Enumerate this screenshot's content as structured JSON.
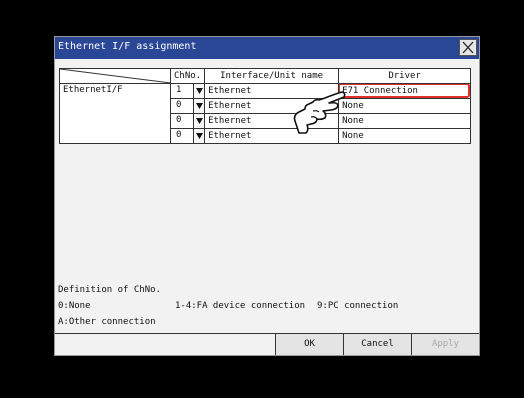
{
  "dialog": {
    "title": "Ethernet I/F assignment"
  },
  "table": {
    "headers": {
      "chno": "ChNo.",
      "interface": "Interface/Unit name",
      "driver": "Driver"
    },
    "group_label": "EthernetI/F",
    "rows": [
      {
        "chno": "1",
        "interface": "Ethernet",
        "driver": "E71 Connection",
        "highlighted": true
      },
      {
        "chno": "0",
        "interface": "Ethernet",
        "driver": "None"
      },
      {
        "chno": "0",
        "interface": "Ethernet",
        "driver": "None"
      },
      {
        "chno": "0",
        "interface": "Ethernet",
        "driver": "None"
      }
    ]
  },
  "definitions": {
    "heading": "Definition of ChNo.",
    "items": [
      "0:None",
      "1-4:FA device connection",
      "9:PC connection",
      "A:Other connection"
    ]
  },
  "buttons": {
    "ok": "OK",
    "cancel": "Cancel",
    "apply": "Apply"
  },
  "colors": {
    "titlebar": "#2a4696",
    "highlight": "#e0302a"
  },
  "icons": {
    "close": "close-icon",
    "pointer": "pointing-hand-icon",
    "dropdown": "dropdown-arrow-icon"
  }
}
